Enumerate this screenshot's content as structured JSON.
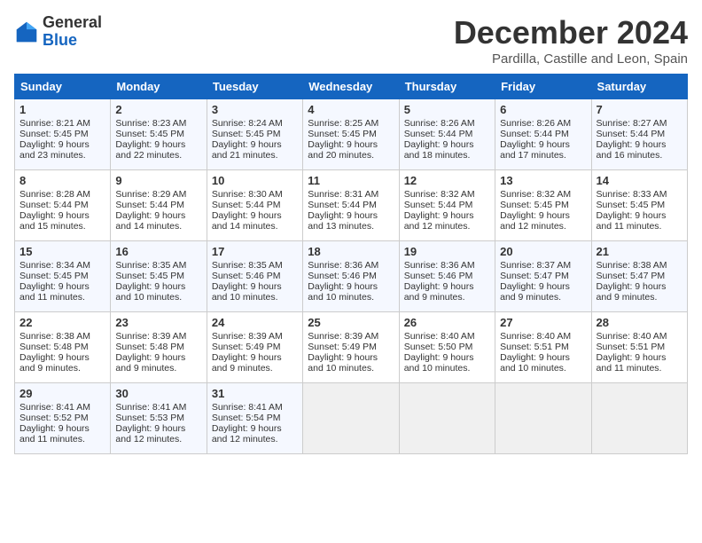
{
  "header": {
    "logo_general": "General",
    "logo_blue": "Blue",
    "month_title": "December 2024",
    "location": "Pardilla, Castille and Leon, Spain"
  },
  "weekdays": [
    "Sunday",
    "Monday",
    "Tuesday",
    "Wednesday",
    "Thursday",
    "Friday",
    "Saturday"
  ],
  "weeks": [
    [
      {
        "day": "1",
        "sunrise": "Sunrise: 8:21 AM",
        "sunset": "Sunset: 5:45 PM",
        "daylight": "Daylight: 9 hours and 23 minutes."
      },
      {
        "day": "2",
        "sunrise": "Sunrise: 8:23 AM",
        "sunset": "Sunset: 5:45 PM",
        "daylight": "Daylight: 9 hours and 22 minutes."
      },
      {
        "day": "3",
        "sunrise": "Sunrise: 8:24 AM",
        "sunset": "Sunset: 5:45 PM",
        "daylight": "Daylight: 9 hours and 21 minutes."
      },
      {
        "day": "4",
        "sunrise": "Sunrise: 8:25 AM",
        "sunset": "Sunset: 5:45 PM",
        "daylight": "Daylight: 9 hours and 20 minutes."
      },
      {
        "day": "5",
        "sunrise": "Sunrise: 8:26 AM",
        "sunset": "Sunset: 5:44 PM",
        "daylight": "Daylight: 9 hours and 18 minutes."
      },
      {
        "day": "6",
        "sunrise": "Sunrise: 8:26 AM",
        "sunset": "Sunset: 5:44 PM",
        "daylight": "Daylight: 9 hours and 17 minutes."
      },
      {
        "day": "7",
        "sunrise": "Sunrise: 8:27 AM",
        "sunset": "Sunset: 5:44 PM",
        "daylight": "Daylight: 9 hours and 16 minutes."
      }
    ],
    [
      {
        "day": "8",
        "sunrise": "Sunrise: 8:28 AM",
        "sunset": "Sunset: 5:44 PM",
        "daylight": "Daylight: 9 hours and 15 minutes."
      },
      {
        "day": "9",
        "sunrise": "Sunrise: 8:29 AM",
        "sunset": "Sunset: 5:44 PM",
        "daylight": "Daylight: 9 hours and 14 minutes."
      },
      {
        "day": "10",
        "sunrise": "Sunrise: 8:30 AM",
        "sunset": "Sunset: 5:44 PM",
        "daylight": "Daylight: 9 hours and 14 minutes."
      },
      {
        "day": "11",
        "sunrise": "Sunrise: 8:31 AM",
        "sunset": "Sunset: 5:44 PM",
        "daylight": "Daylight: 9 hours and 13 minutes."
      },
      {
        "day": "12",
        "sunrise": "Sunrise: 8:32 AM",
        "sunset": "Sunset: 5:44 PM",
        "daylight": "Daylight: 9 hours and 12 minutes."
      },
      {
        "day": "13",
        "sunrise": "Sunrise: 8:32 AM",
        "sunset": "Sunset: 5:45 PM",
        "daylight": "Daylight: 9 hours and 12 minutes."
      },
      {
        "day": "14",
        "sunrise": "Sunrise: 8:33 AM",
        "sunset": "Sunset: 5:45 PM",
        "daylight": "Daylight: 9 hours and 11 minutes."
      }
    ],
    [
      {
        "day": "15",
        "sunrise": "Sunrise: 8:34 AM",
        "sunset": "Sunset: 5:45 PM",
        "daylight": "Daylight: 9 hours and 11 minutes."
      },
      {
        "day": "16",
        "sunrise": "Sunrise: 8:35 AM",
        "sunset": "Sunset: 5:45 PM",
        "daylight": "Daylight: 9 hours and 10 minutes."
      },
      {
        "day": "17",
        "sunrise": "Sunrise: 8:35 AM",
        "sunset": "Sunset: 5:46 PM",
        "daylight": "Daylight: 9 hours and 10 minutes."
      },
      {
        "day": "18",
        "sunrise": "Sunrise: 8:36 AM",
        "sunset": "Sunset: 5:46 PM",
        "daylight": "Daylight: 9 hours and 10 minutes."
      },
      {
        "day": "19",
        "sunrise": "Sunrise: 8:36 AM",
        "sunset": "Sunset: 5:46 PM",
        "daylight": "Daylight: 9 hours and 9 minutes."
      },
      {
        "day": "20",
        "sunrise": "Sunrise: 8:37 AM",
        "sunset": "Sunset: 5:47 PM",
        "daylight": "Daylight: 9 hours and 9 minutes."
      },
      {
        "day": "21",
        "sunrise": "Sunrise: 8:38 AM",
        "sunset": "Sunset: 5:47 PM",
        "daylight": "Daylight: 9 hours and 9 minutes."
      }
    ],
    [
      {
        "day": "22",
        "sunrise": "Sunrise: 8:38 AM",
        "sunset": "Sunset: 5:48 PM",
        "daylight": "Daylight: 9 hours and 9 minutes."
      },
      {
        "day": "23",
        "sunrise": "Sunrise: 8:39 AM",
        "sunset": "Sunset: 5:48 PM",
        "daylight": "Daylight: 9 hours and 9 minutes."
      },
      {
        "day": "24",
        "sunrise": "Sunrise: 8:39 AM",
        "sunset": "Sunset: 5:49 PM",
        "daylight": "Daylight: 9 hours and 9 minutes."
      },
      {
        "day": "25",
        "sunrise": "Sunrise: 8:39 AM",
        "sunset": "Sunset: 5:49 PM",
        "daylight": "Daylight: 9 hours and 10 minutes."
      },
      {
        "day": "26",
        "sunrise": "Sunrise: 8:40 AM",
        "sunset": "Sunset: 5:50 PM",
        "daylight": "Daylight: 9 hours and 10 minutes."
      },
      {
        "day": "27",
        "sunrise": "Sunrise: 8:40 AM",
        "sunset": "Sunset: 5:51 PM",
        "daylight": "Daylight: 9 hours and 10 minutes."
      },
      {
        "day": "28",
        "sunrise": "Sunrise: 8:40 AM",
        "sunset": "Sunset: 5:51 PM",
        "daylight": "Daylight: 9 hours and 11 minutes."
      }
    ],
    [
      {
        "day": "29",
        "sunrise": "Sunrise: 8:41 AM",
        "sunset": "Sunset: 5:52 PM",
        "daylight": "Daylight: 9 hours and 11 minutes."
      },
      {
        "day": "30",
        "sunrise": "Sunrise: 8:41 AM",
        "sunset": "Sunset: 5:53 PM",
        "daylight": "Daylight: 9 hours and 12 minutes."
      },
      {
        "day": "31",
        "sunrise": "Sunrise: 8:41 AM",
        "sunset": "Sunset: 5:54 PM",
        "daylight": "Daylight: 9 hours and 12 minutes."
      },
      null,
      null,
      null,
      null
    ]
  ]
}
